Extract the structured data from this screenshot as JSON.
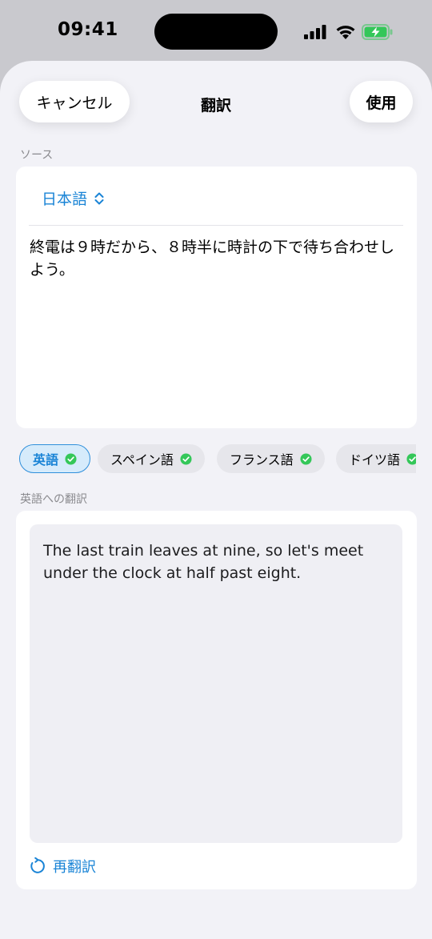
{
  "status_bar": {
    "time": "09:41",
    "icons": [
      "signal-icon",
      "wifi-icon",
      "battery-charging-icon"
    ],
    "battery_color": "#34c759"
  },
  "nav": {
    "cancel_label": "キャンセル",
    "title": "翻訳",
    "use_label": "使用"
  },
  "source": {
    "section_label": "ソース",
    "language": "日本語",
    "text": "終電は９時だから、８時半に時計の下で待ち合わせしよう。"
  },
  "languages": [
    {
      "label": "英語",
      "selected": true,
      "downloaded": true
    },
    {
      "label": "スペイン語",
      "selected": false,
      "downloaded": true
    },
    {
      "label": "フランス語",
      "selected": false,
      "downloaded": true
    },
    {
      "label": "ドイツ語",
      "selected": false,
      "downloaded": true
    }
  ],
  "target": {
    "section_label": "英語への翻訳",
    "text": "The last train leaves at nine, so let's meet under the clock at half past eight.",
    "retranslate_label": "再翻訳"
  },
  "colors": {
    "accent": "#1a84d6",
    "check": "#34c759",
    "background": "#f2f2f7"
  }
}
